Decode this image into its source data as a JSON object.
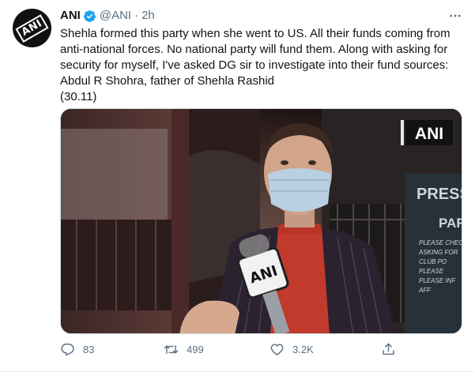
{
  "tweet": {
    "author": {
      "display_name": "ANI",
      "handle": "@ANI",
      "separator": "·",
      "time": "2h",
      "avatar_text": "ANI",
      "verified": true
    },
    "text": {
      "line1": "Shehla formed this party when she went to US. All their funds coming from",
      "line2": "anti-national forces. No national party will fund them. Along with asking for",
      "line3": "security for myself, I've asked DG sir to investigate into their fund sources:",
      "line4": "Abdul R Shohra, father of Shehla Rashid",
      "line5": "(30.11)"
    },
    "media": {
      "watermark": "ANI",
      "mic_label": "ANI",
      "sign_text_1": "PRESS",
      "sign_text_2": "PAR",
      "sign_small": [
        "PLEASE CHECK",
        "ASKING FOR",
        "CLUB PO",
        "PLEASE",
        "PLEASE INF",
        "AFF"
      ]
    },
    "actions": {
      "replies": "83",
      "retweets": "499",
      "likes": "3.2K"
    },
    "colors": {
      "verified": "#1da1f2",
      "muted": "#5b7083",
      "text": "#0f1419"
    }
  }
}
